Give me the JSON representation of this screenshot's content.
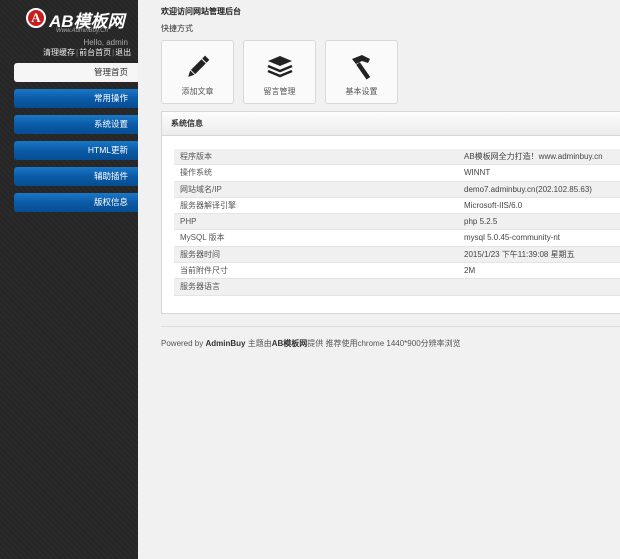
{
  "sidebar": {
    "logo_badge": "A",
    "logo_text": "AB模板网",
    "logo_sub": "Www.AdminBuy.Cn",
    "hello": "Hello, admin",
    "links": [
      "清理缓存",
      "前台首页",
      "退出"
    ],
    "separator": "|",
    "nav": [
      {
        "label": "管理首页",
        "active": true
      },
      {
        "label": "常用操作",
        "active": false
      },
      {
        "label": "系统设置",
        "active": false
      },
      {
        "label": "HTML更新",
        "active": false
      },
      {
        "label": "辅助插件",
        "active": false
      },
      {
        "label": "版权信息",
        "active": false
      }
    ]
  },
  "main": {
    "welcome": "欢迎访问网站管理后台",
    "quick_label": "快捷方式",
    "quick": [
      {
        "label": "添加文章",
        "icon": "pencil-icon"
      },
      {
        "label": "留言管理",
        "icon": "stack-icon"
      },
      {
        "label": "基本设置",
        "icon": "hammer-icon"
      }
    ],
    "panel_title": "系统信息",
    "info": [
      {
        "key": "程序版本",
        "value": "AB模板网全力打造！www.adminbuy.cn"
      },
      {
        "key": "操作系统",
        "value": "WINNT"
      },
      {
        "key": "网站域名/IP",
        "value": "demo7.adminbuy.cn(202.102.85.63)"
      },
      {
        "key": "服务器解译引擎",
        "value": "Microsoft-IIS/6.0"
      },
      {
        "key": "PHP",
        "value": "php 5.2.5"
      },
      {
        "key": "MySQL 版本",
        "value": "mysql 5.0.45-community-nt"
      },
      {
        "key": "服务器时间",
        "value": "2015/1/23 下午11:39:08 星期五"
      },
      {
        "key": "当前附件尺寸",
        "value": "2M"
      },
      {
        "key": "服务器语言",
        "value": ""
      }
    ],
    "footer": {
      "prefix": "Powered by ",
      "brand": "AdminBuy",
      "mid": " 主题由",
      "brand2": "AB模板网",
      "suffix": "提供 推荐使用chrome 1440*900分辨率浏览"
    }
  },
  "colors": {
    "accent": "#0b5aa6",
    "sidebar_bg": "#2a2a2a",
    "logo_red": "#c81e1e"
  }
}
